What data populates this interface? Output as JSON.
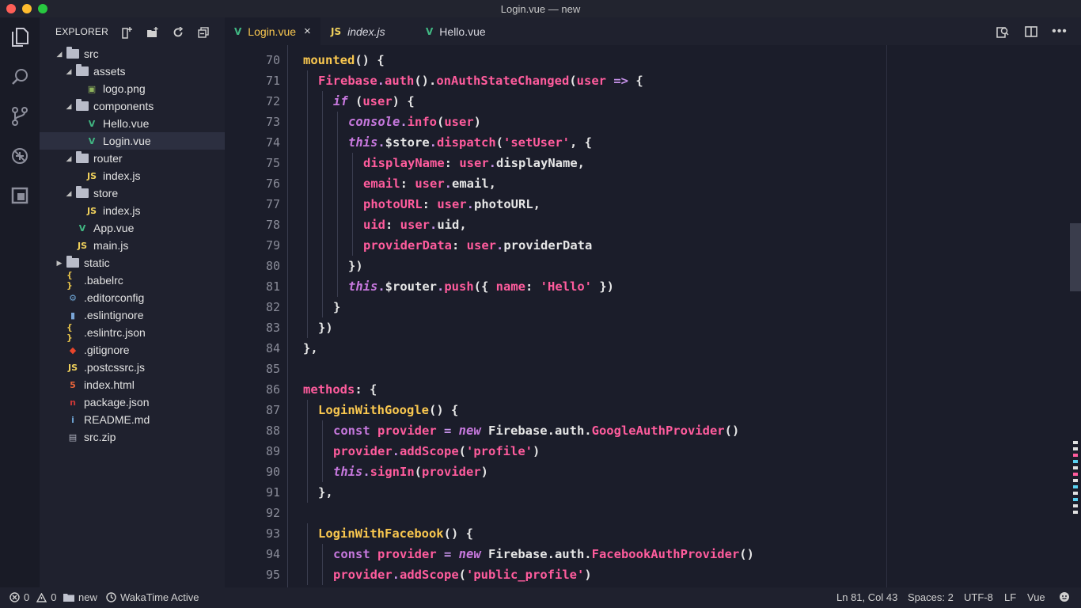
{
  "window": {
    "title": "Login.vue — new"
  },
  "explorer": {
    "header": "EXPLORER",
    "actions": [
      "new-file-icon",
      "new-folder-icon",
      "refresh-icon",
      "collapse-all-icon"
    ],
    "tree": [
      {
        "label": "src",
        "depth": 0,
        "type": "folder",
        "state": "open"
      },
      {
        "label": "assets",
        "depth": 1,
        "type": "folder",
        "state": "open"
      },
      {
        "label": "logo.png",
        "depth": 2,
        "type": "image"
      },
      {
        "label": "components",
        "depth": 1,
        "type": "folder",
        "state": "open"
      },
      {
        "label": "Hello.vue",
        "depth": 2,
        "type": "vue"
      },
      {
        "label": "Login.vue",
        "depth": 2,
        "type": "vue",
        "selected": true
      },
      {
        "label": "router",
        "depth": 1,
        "type": "folder",
        "state": "open"
      },
      {
        "label": "index.js",
        "depth": 2,
        "type": "js"
      },
      {
        "label": "store",
        "depth": 1,
        "type": "folder",
        "state": "open"
      },
      {
        "label": "index.js",
        "depth": 2,
        "type": "js"
      },
      {
        "label": "App.vue",
        "depth": 1,
        "type": "vue"
      },
      {
        "label": "main.js",
        "depth": 1,
        "type": "js"
      },
      {
        "label": "static",
        "depth": 0,
        "type": "folder",
        "state": "closed"
      },
      {
        "label": ".babelrc",
        "depth": 0,
        "type": "json"
      },
      {
        "label": ".editorconfig",
        "depth": 0,
        "type": "gear"
      },
      {
        "label": ".eslintignore",
        "depth": 0,
        "type": "file"
      },
      {
        "label": ".eslintrc.json",
        "depth": 0,
        "type": "json"
      },
      {
        "label": ".gitignore",
        "depth": 0,
        "type": "git"
      },
      {
        "label": ".postcssrc.js",
        "depth": 0,
        "type": "js"
      },
      {
        "label": "index.html",
        "depth": 0,
        "type": "html"
      },
      {
        "label": "package.json",
        "depth": 0,
        "type": "npm"
      },
      {
        "label": "README.md",
        "depth": 0,
        "type": "info"
      },
      {
        "label": "src.zip",
        "depth": 0,
        "type": "zip"
      }
    ]
  },
  "tabs": [
    {
      "label": "Login.vue",
      "icon": "V",
      "active": true,
      "close": "×"
    },
    {
      "label": "index.js",
      "icon": "JS",
      "active": false
    },
    {
      "label": "Hello.vue",
      "icon": "V",
      "active": false
    }
  ],
  "editor": {
    "lines": [
      {
        "n": "70",
        "indent": 0,
        "t": [
          [
            "mounted",
            "#f9c74f"
          ],
          [
            "() {",
            "#e6e6e6"
          ]
        ]
      },
      {
        "n": "71",
        "indent": 1,
        "t": [
          [
            "Firebase",
            "#ff5c9d"
          ],
          [
            ".",
            "#c792ea"
          ],
          [
            "auth",
            "#ff5c9d"
          ],
          [
            "().",
            "#e6e6e6"
          ],
          [
            "onAuthStateChanged",
            "#ff5c9d"
          ],
          [
            "(",
            "#e6e6e6"
          ],
          [
            "user",
            "#ff5c9d"
          ],
          [
            " => ",
            "#c792ea"
          ],
          [
            "{",
            "#e6e6e6"
          ]
        ]
      },
      {
        "n": "72",
        "indent": 2,
        "t": [
          [
            "if",
            "#c678dd",
            "i"
          ],
          [
            " (",
            "#e6e6e6"
          ],
          [
            "user",
            "#ff5c9d"
          ],
          [
            ") {",
            "#e6e6e6"
          ]
        ]
      },
      {
        "n": "73",
        "indent": 3,
        "t": [
          [
            "console",
            "#c678dd",
            "i"
          ],
          [
            ".",
            "#c792ea"
          ],
          [
            "info",
            "#ff5c9d"
          ],
          [
            "(",
            "#e6e6e6"
          ],
          [
            "user",
            "#ff5c9d"
          ],
          [
            ")",
            "#e6e6e6"
          ]
        ]
      },
      {
        "n": "74",
        "indent": 3,
        "t": [
          [
            "this",
            "#c678dd",
            "i"
          ],
          [
            ".",
            "#c792ea"
          ],
          [
            "$store",
            "#e6e6e6"
          ],
          [
            ".",
            "#c792ea"
          ],
          [
            "dispatch",
            "#ff5c9d"
          ],
          [
            "(",
            "#e6e6e6"
          ],
          [
            "'setUser'",
            "#ff5c9d"
          ],
          [
            ", {",
            "#e6e6e6"
          ]
        ]
      },
      {
        "n": "75",
        "indent": 4,
        "t": [
          [
            "displayName",
            "#ff5c9d"
          ],
          [
            ": ",
            "#e6e6e6"
          ],
          [
            "user",
            "#ff5c9d"
          ],
          [
            ".",
            "#c792ea"
          ],
          [
            "displayName,",
            "#e6e6e6"
          ]
        ]
      },
      {
        "n": "76",
        "indent": 4,
        "t": [
          [
            "email",
            "#ff5c9d"
          ],
          [
            ": ",
            "#e6e6e6"
          ],
          [
            "user",
            "#ff5c9d"
          ],
          [
            ".",
            "#c792ea"
          ],
          [
            "email,",
            "#e6e6e6"
          ]
        ]
      },
      {
        "n": "77",
        "indent": 4,
        "t": [
          [
            "photoURL",
            "#ff5c9d"
          ],
          [
            ": ",
            "#e6e6e6"
          ],
          [
            "user",
            "#ff5c9d"
          ],
          [
            ".",
            "#c792ea"
          ],
          [
            "photoURL,",
            "#e6e6e6"
          ]
        ]
      },
      {
        "n": "78",
        "indent": 4,
        "t": [
          [
            "uid",
            "#ff5c9d"
          ],
          [
            ": ",
            "#e6e6e6"
          ],
          [
            "user",
            "#ff5c9d"
          ],
          [
            ".",
            "#c792ea"
          ],
          [
            "uid,",
            "#e6e6e6"
          ]
        ]
      },
      {
        "n": "79",
        "indent": 4,
        "t": [
          [
            "providerData",
            "#ff5c9d"
          ],
          [
            ": ",
            "#e6e6e6"
          ],
          [
            "user",
            "#ff5c9d"
          ],
          [
            ".",
            "#c792ea"
          ],
          [
            "providerData",
            "#e6e6e6"
          ]
        ]
      },
      {
        "n": "80",
        "indent": 3,
        "t": [
          [
            "})",
            "#e6e6e6"
          ]
        ]
      },
      {
        "n": "81",
        "indent": 3,
        "t": [
          [
            "this",
            "#c678dd",
            "i"
          ],
          [
            ".",
            "#c792ea"
          ],
          [
            "$router",
            "#e6e6e6"
          ],
          [
            ".",
            "#c792ea"
          ],
          [
            "push",
            "#ff5c9d"
          ],
          [
            "({ ",
            "#e6e6e6"
          ],
          [
            "name",
            "#ff5c9d"
          ],
          [
            ": ",
            "#e6e6e6"
          ],
          [
            "'Hello'",
            "#ff5c9d"
          ],
          [
            " })",
            "#e6e6e6"
          ]
        ]
      },
      {
        "n": "82",
        "indent": 2,
        "t": [
          [
            "}",
            "#e6e6e6"
          ]
        ]
      },
      {
        "n": "83",
        "indent": 1,
        "t": [
          [
            "})",
            "#e6e6e6"
          ]
        ]
      },
      {
        "n": "84",
        "indent": 0,
        "t": [
          [
            "},",
            "#e6e6e6"
          ]
        ]
      },
      {
        "n": "85",
        "indent": 0,
        "t": []
      },
      {
        "n": "86",
        "indent": 0,
        "t": [
          [
            "methods",
            "#ff5c9d"
          ],
          [
            ": {",
            "#e6e6e6"
          ]
        ]
      },
      {
        "n": "87",
        "indent": 1,
        "t": [
          [
            "LoginWithGoogle",
            "#f9c74f"
          ],
          [
            "() {",
            "#e6e6e6"
          ]
        ]
      },
      {
        "n": "88",
        "indent": 2,
        "t": [
          [
            "const ",
            "#c678dd"
          ],
          [
            "provider",
            "#ff5c9d"
          ],
          [
            " = ",
            "#c792ea"
          ],
          [
            "new",
            "#c678dd",
            "i"
          ],
          [
            " Firebase.auth.",
            "#e6e6e6"
          ],
          [
            "GoogleAuthProvider",
            "#ff5c9d"
          ],
          [
            "()",
            "#e6e6e6"
          ]
        ]
      },
      {
        "n": "89",
        "indent": 2,
        "t": [
          [
            "provider",
            "#ff5c9d"
          ],
          [
            ".",
            "#c792ea"
          ],
          [
            "addScope",
            "#ff5c9d"
          ],
          [
            "(",
            "#e6e6e6"
          ],
          [
            "'profile'",
            "#ff5c9d"
          ],
          [
            ")",
            "#e6e6e6"
          ]
        ]
      },
      {
        "n": "90",
        "indent": 2,
        "t": [
          [
            "this",
            "#c678dd",
            "i"
          ],
          [
            ".",
            "#c792ea"
          ],
          [
            "signIn",
            "#ff5c9d"
          ],
          [
            "(",
            "#e6e6e6"
          ],
          [
            "provider",
            "#ff5c9d"
          ],
          [
            ")",
            "#e6e6e6"
          ]
        ]
      },
      {
        "n": "91",
        "indent": 1,
        "t": [
          [
            "},",
            "#e6e6e6"
          ]
        ]
      },
      {
        "n": "92",
        "indent": 0,
        "t": []
      },
      {
        "n": "93",
        "indent": 1,
        "t": [
          [
            "LoginWithFacebook",
            "#f9c74f"
          ],
          [
            "() {",
            "#e6e6e6"
          ]
        ]
      },
      {
        "n": "94",
        "indent": 2,
        "t": [
          [
            "const ",
            "#c678dd"
          ],
          [
            "provider",
            "#ff5c9d"
          ],
          [
            " = ",
            "#c792ea"
          ],
          [
            "new",
            "#c678dd",
            "i"
          ],
          [
            " Firebase.auth.",
            "#e6e6e6"
          ],
          [
            "FacebookAuthProvider",
            "#ff5c9d"
          ],
          [
            "()",
            "#e6e6e6"
          ]
        ]
      },
      {
        "n": "95",
        "indent": 2,
        "t": [
          [
            "provider",
            "#ff5c9d"
          ],
          [
            ".",
            "#c792ea"
          ],
          [
            "addScope",
            "#ff5c9d"
          ],
          [
            "(",
            "#e6e6e6"
          ],
          [
            "'public_profile'",
            "#ff5c9d"
          ],
          [
            ")",
            "#e6e6e6"
          ]
        ]
      }
    ]
  },
  "statusbar": {
    "errors": "0",
    "warnings": "0",
    "folder": "new",
    "wakatime": "WakaTime Active",
    "position": "Ln 81, Col 43",
    "spaces": "Spaces: 2",
    "encoding": "UTF-8",
    "eol": "LF",
    "language": "Vue"
  },
  "colors": {
    "vue": "#41b883",
    "js": "#f0d15c",
    "accent_pink": "#ff5c9d",
    "accent_yellow": "#f9c74f",
    "keyword_purple": "#c678dd"
  }
}
